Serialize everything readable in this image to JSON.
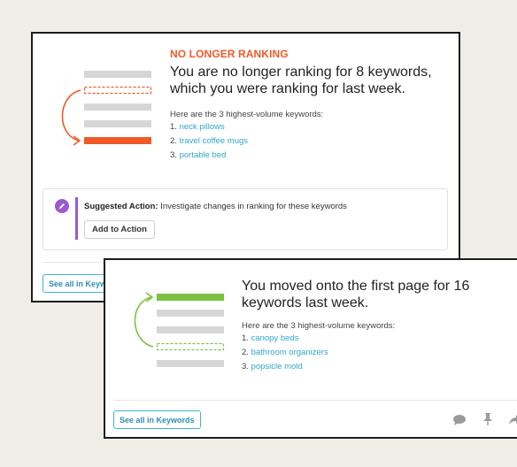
{
  "card1": {
    "section_title": "NO LONGER RANKING",
    "headline": "You are no longer ranking for 8 keywords, which you were ranking for last week.",
    "subtext": "Here are the 3 highest-volume keywords:",
    "keywords": [
      {
        "num": "1.",
        "text": "neck pillows"
      },
      {
        "num": "2.",
        "text": "travel coffee mugs"
      },
      {
        "num": "3.",
        "text": "portable bed"
      }
    ],
    "suggested_action": {
      "label": "Suggested Action:",
      "text": "Investigate changes in ranking for these keywords",
      "button": "Add to Action"
    },
    "see_all_button": "See all in Keywords",
    "illustration_color": "#f05a28"
  },
  "card2": {
    "headline": "You moved onto the first page for 16 keywords last week.",
    "subtext": "Here are the 3 highest-volume keywords:",
    "keywords": [
      {
        "num": "1.",
        "text": "canopy beds"
      },
      {
        "num": "2.",
        "text": "bathroom organizers"
      },
      {
        "num": "3.",
        "text": "popsicle mold"
      }
    ],
    "see_all_button": "See all in Keywords",
    "illustration_color": "#7cc142",
    "footer_icons": [
      "comment-icon",
      "pin-icon",
      "share-icon"
    ]
  }
}
